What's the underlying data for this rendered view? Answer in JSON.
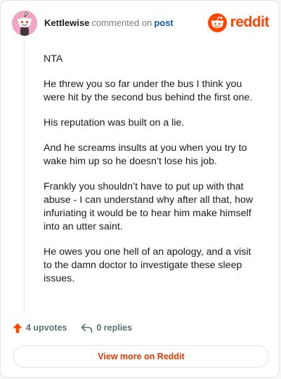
{
  "comment": {
    "username": "Kettlewise",
    "action": "commented on",
    "link_text": "post",
    "paragraphs": [
      "NTA",
      "He threw you so far under the bus I think you were hit by the second bus behind the first one.",
      "His reputation was built on a lie.",
      "And he screams insults at you when you try to wake him up so he doesn’t lose his job.",
      "Frankly you shouldn’t have to put up with that abuse - I can understand why after all that, how infuriating it would be to hear him make himself into an utter saint.",
      "He owes you one hell of an apology, and a visit to the damn doctor to investigate these sleep issues."
    ]
  },
  "brand": {
    "wordmark": "reddit",
    "icon": "reddit-logo-icon",
    "color": "#ff4500"
  },
  "avatar": {
    "icon": "snoo-avatar-icon",
    "background": "#f2a5c3"
  },
  "actions": {
    "upvotes_label": "4 upvotes",
    "replies_label": "0 replies",
    "upvote_icon": "upvote-arrow-icon",
    "upvote_color": "#ff4500",
    "reply_icon": "reply-arrow-icon"
  },
  "footer": {
    "view_more_label": "View more on Reddit",
    "view_more_color": "#d93a00"
  }
}
